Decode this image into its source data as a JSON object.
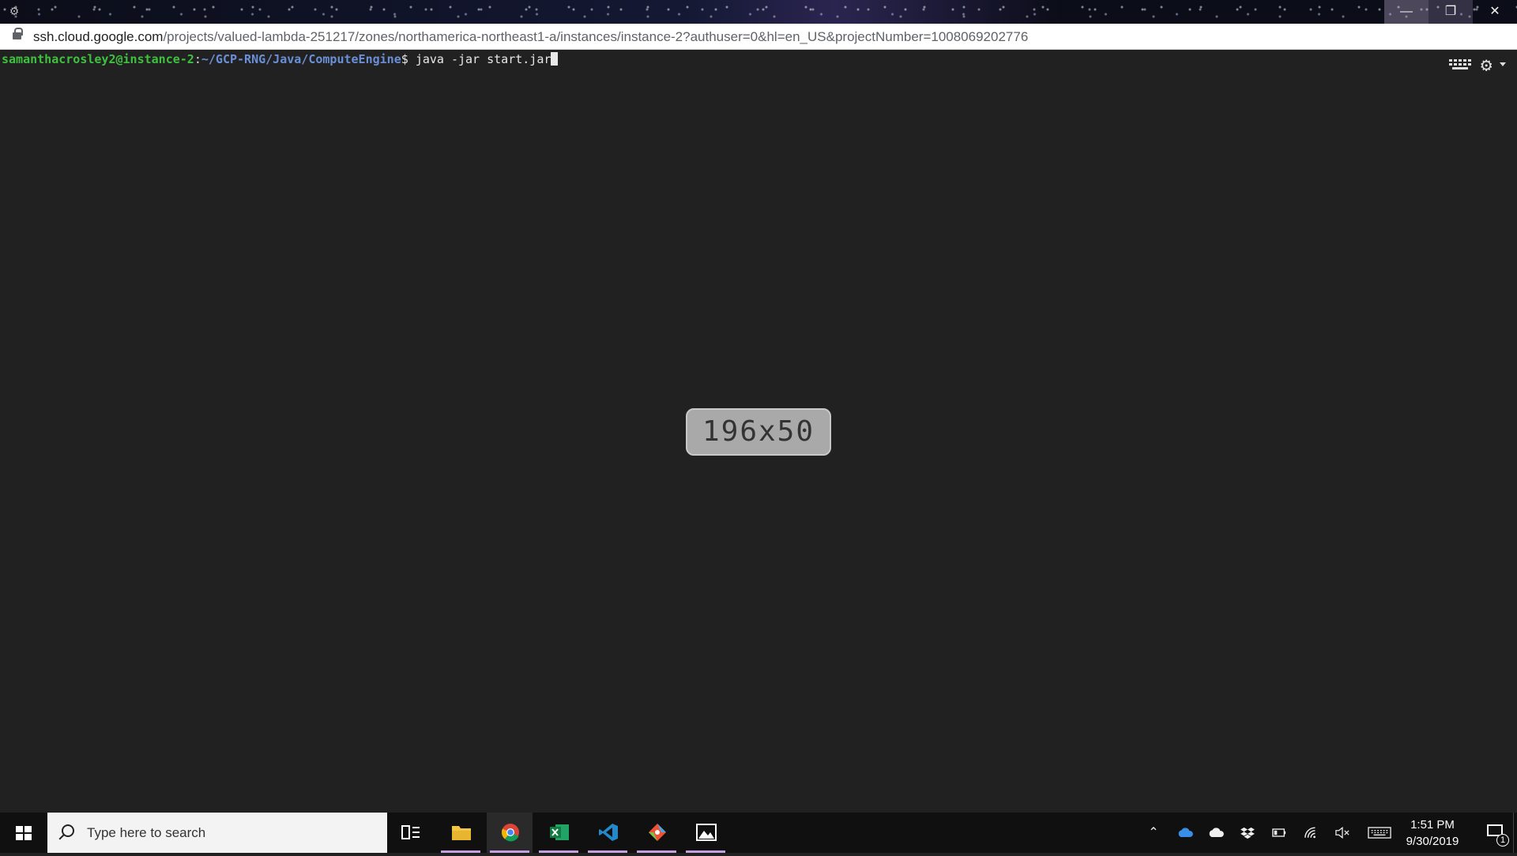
{
  "window": {
    "app_icon": "cloud-shell-icon",
    "controls": [
      "minimize",
      "maximize",
      "close"
    ]
  },
  "address": {
    "host": "ssh.cloud.google.com",
    "path": "/projects/valued-lambda-251217/zones/northamerica-northeast1-a/instances/instance-2?authuser=0&hl=en_US&projectNumber=1008069202776"
  },
  "terminal": {
    "user_host": "samanthacrosley2@instance-2",
    "separator": ":",
    "path": "~/GCP-RNG/Java/ComputeEngine",
    "prompt": "$ ",
    "command": "java -jar start.jar",
    "size_overlay": "196x50"
  },
  "taskbar": {
    "search_placeholder": "Type here to search",
    "apps": [
      "task-view",
      "file-explorer",
      "chrome",
      "excel",
      "vscode",
      "git",
      "photos"
    ],
    "clock_time": "1:51 PM",
    "clock_date": "9/30/2019",
    "notification_count": "1"
  },
  "colors": {
    "terminal_bg": "#212121",
    "prompt_user": "#3ec13e",
    "prompt_path": "#6b8fd6",
    "taskbar_bg": "#101010",
    "active_indicator": "#c59fe0"
  }
}
